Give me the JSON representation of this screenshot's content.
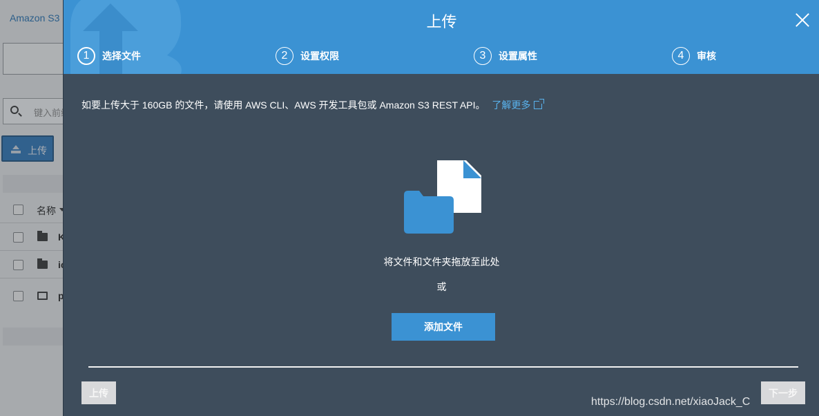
{
  "background": {
    "brand": "Amazon S3",
    "search_placeholder": "键入前缀",
    "upload_button": "上传",
    "table_header_name": "名称",
    "rows": [
      {
        "type": "folder",
        "name": "K"
      },
      {
        "type": "folder",
        "name": "ic"
      },
      {
        "type": "image",
        "name": "pr"
      }
    ]
  },
  "modal": {
    "title": "上传",
    "steps": [
      {
        "num": "1",
        "label": "选择文件",
        "active": true
      },
      {
        "num": "2",
        "label": "设置权限",
        "active": false
      },
      {
        "num": "3",
        "label": "设置属性",
        "active": false
      },
      {
        "num": "4",
        "label": "审核",
        "active": false
      }
    ],
    "notice": "如要上传大于 160GB 的文件，请使用 AWS CLI、AWS 开发工具包或 Amazon S3 REST API。",
    "learn_more": "了解更多",
    "drop_text": "将文件和文件夹拖放至此处",
    "or_text": "或",
    "add_files_button": "添加文件",
    "footer_upload_button": "上传",
    "footer_next_button": "下一步"
  },
  "watermark": "https://blog.csdn.net/xiaoJack_C",
  "colors": {
    "header_blue": "#3b92d3",
    "modal_body": "#3e4d5c",
    "link_blue": "#59b3ee"
  },
  "icons": [
    "close-icon",
    "external-link-icon",
    "file-icon",
    "folder-icon",
    "search-icon",
    "upload-icon"
  ]
}
